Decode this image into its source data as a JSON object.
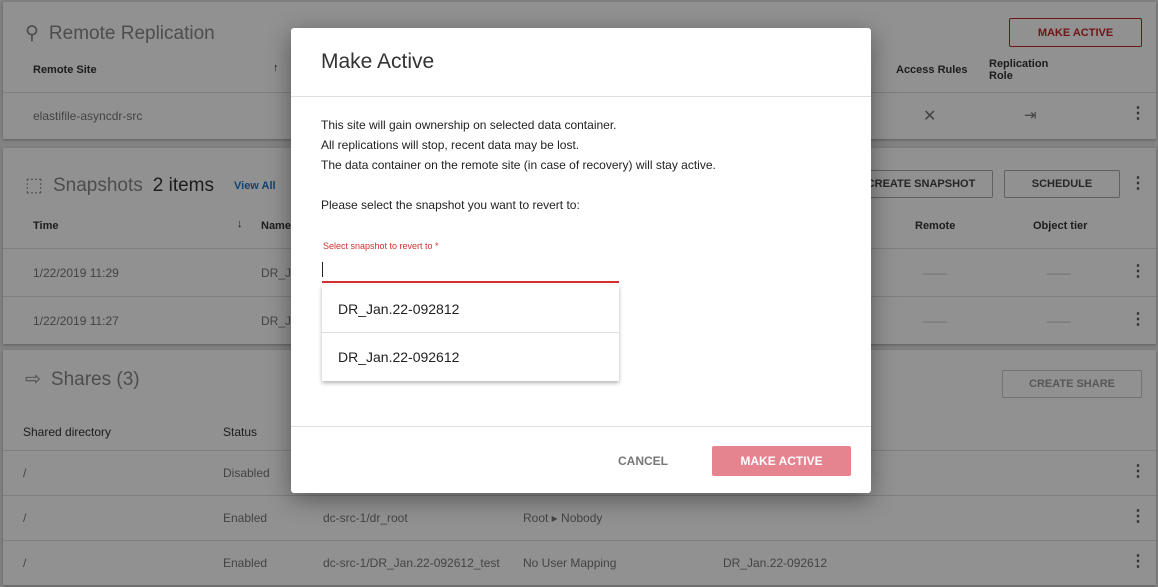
{
  "replication": {
    "title": "Remote Replication",
    "make_active": "MAKE ACTIVE",
    "headers": {
      "remote_site": "Remote Site",
      "access_rules": "Access Rules",
      "replication_role": "Replication Role"
    },
    "row": {
      "remote_site": "elastifile-asyncdr-src"
    }
  },
  "snapshots": {
    "title": "Snapshots",
    "count": "2 items",
    "view_all": "View All",
    "create": "CREATE SNAPSHOT",
    "schedule": "SCHEDULE",
    "headers": {
      "time": "Time",
      "name": "Name",
      "remote": "Remote",
      "object_tier": "Object tier"
    },
    "rows": [
      {
        "time": "1/22/2019 11:29",
        "name": "DR_Ja",
        "remote": "——",
        "object_tier": "——"
      },
      {
        "time": "1/22/2019 11:27",
        "name": "DR_Ja",
        "remote": "——",
        "object_tier": "——"
      }
    ]
  },
  "shares": {
    "title": "Shares (3)",
    "create": "CREATE SHARE",
    "headers": {
      "dir": "Shared directory",
      "status": "Status"
    },
    "rows": [
      {
        "dir": "/",
        "status": "Disabled",
        "path": "",
        "mapping": "",
        "snapshot": ""
      },
      {
        "dir": "/",
        "status": "Enabled",
        "path": "dc-src-1/dr_root",
        "mapping": "Root ▸ Nobody",
        "snapshot": ""
      },
      {
        "dir": "/",
        "status": "Enabled",
        "path": "dc-src-1/DR_Jan.22-092612_test",
        "mapping": "No User Mapping",
        "snapshot": "DR_Jan.22-092612"
      }
    ]
  },
  "modal": {
    "title": "Make Active",
    "lines": [
      "This site will gain ownership on selected data container.",
      "All replications will stop, recent data may be lost.",
      "The data container on the remote site (in case of recovery) will stay active."
    ],
    "prompt": "Please select the snapshot you want to revert to:",
    "field_label": "Select snapshot to revert to *",
    "field_value": "",
    "options": [
      "DR_Jan.22-092812",
      "DR_Jan.22-092612"
    ],
    "cancel": "CANCEL",
    "confirm": "MAKE ACTIVE"
  },
  "colors": {
    "accent": "#c62828",
    "confirm_bg": "#e5838f",
    "link": "#1976d2"
  }
}
